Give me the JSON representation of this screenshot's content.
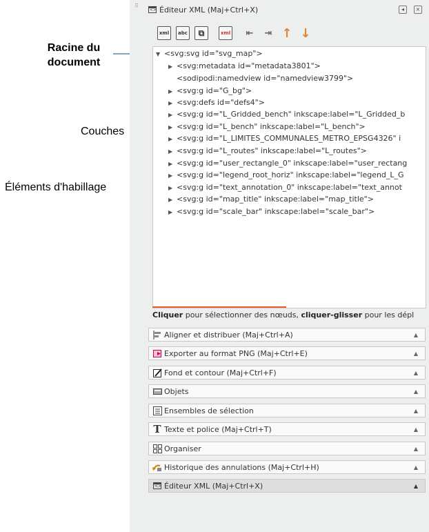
{
  "annotations": {
    "root_line1": "Racine du",
    "root_line2": "document",
    "layers": "Couches",
    "dressing": "Éléments d'habillage"
  },
  "dock": {
    "title": "Éditeur XML (Maj+Ctrl+X)",
    "handle": "⠿"
  },
  "toolbar": {
    "new_element_label": "xml",
    "new_text_label": "abc",
    "duplicate_label": "⧉",
    "delete_label": "xml",
    "unindent": "⇤",
    "indent": "⇥",
    "raise": "↑",
    "lower": "↓"
  },
  "tree": {
    "root": "<svg:svg id=\"svg_map\">",
    "nodes": [
      "<svg:metadata id=\"metadata3801\">",
      "<sodipodi:namedview id=\"namedview3799\">",
      "<svg:g id=\"G_bg\">",
      "<svg:defs id=\"defs4\">",
      "<svg:g id=\"L_Gridded_bench\" inkscape:label=\"L_Gridded_b",
      "<svg:g id=\"L_bench\" inkscape:label=\"L_bench\">",
      "<svg:g id=\"L_LIMITES_COMMUNALES_METRO_EPSG4326\" i",
      "<svg:g id=\"L_routes\" inkscape:label=\"L_routes\">",
      "<svg:g id=\"user_rectangle_0\" inkscape:label=\"user_rectang",
      "<svg:g id=\"legend_root_horiz\" inkscape:label=\"legend_L_G",
      "<svg:g id=\"text_annotation_0\" inkscape:label=\"text_annot",
      "<svg:g id=\"map_title\" inkscape:label=\"map_title\">",
      "<svg:g id=\"scale_bar\" inkscape:label=\"scale_bar\">"
    ]
  },
  "hint": {
    "b1": "Cliquer",
    "t1": " pour sélectionner des nœuds, ",
    "b2": "cliquer-glisser",
    "t2": " pour les dépl"
  },
  "dialogs": [
    {
      "label": "Aligner et distribuer (Maj+Ctrl+A)",
      "icon": "align-icon"
    },
    {
      "label": "Exporter au format PNG (Maj+Ctrl+E)",
      "icon": "export-png-icon"
    },
    {
      "label": "Fond et contour (Maj+Ctrl+F)",
      "icon": "fill-stroke-icon"
    },
    {
      "label": "Objets",
      "icon": "objects-icon"
    },
    {
      "label": "Ensembles de sélection",
      "icon": "selection-sets-icon"
    },
    {
      "label": "Texte et police (Maj+Ctrl+T)",
      "icon": "text-font-icon"
    },
    {
      "label": "Organiser",
      "icon": "arrange-icon"
    },
    {
      "label": "Historique des annulations (Maj+Ctrl+H)",
      "icon": "undo-history-icon"
    },
    {
      "label": "Éditeur XML (Maj+Ctrl+X)",
      "icon": "xml-editor-icon"
    }
  ],
  "colors": {
    "accent_orange": "#e08438",
    "panel_bg": "#edeeee",
    "tree_bg": "#ffffff",
    "focus_bar": "#e55a2b"
  }
}
